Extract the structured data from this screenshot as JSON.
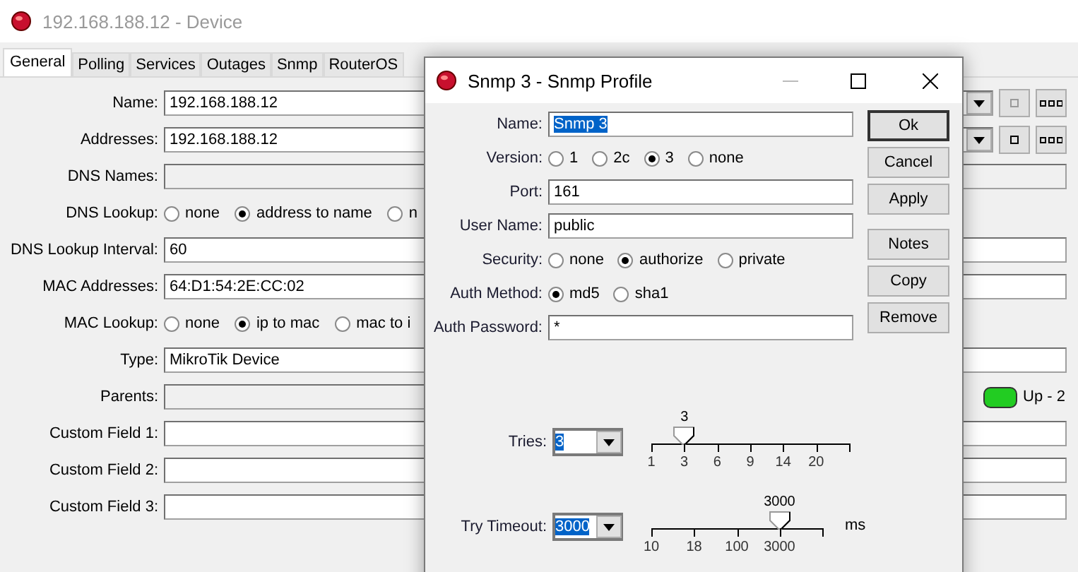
{
  "device_window": {
    "title": "192.168.188.12 - Device",
    "tabs": [
      {
        "label": "General",
        "selected": true
      },
      {
        "label": "Polling",
        "selected": false
      },
      {
        "label": "Services",
        "selected": false
      },
      {
        "label": "Outages",
        "selected": false
      },
      {
        "label": "Snmp",
        "selected": false
      },
      {
        "label": "RouterOS",
        "selected": false
      }
    ],
    "fields": [
      {
        "kind": "combo",
        "label": "Name:",
        "value": "192.168.188.12",
        "disabled": false
      },
      {
        "kind": "combo",
        "label": "Addresses:",
        "value": "192.168.188.12",
        "disabled": false
      },
      {
        "kind": "text",
        "label": "DNS Names:",
        "disabled": true
      },
      {
        "kind": "radio",
        "label": "DNS Lookup:",
        "options": [
          {
            "label": "none",
            "selected": false
          },
          {
            "label": "address to name",
            "selected": true
          },
          {
            "label": "n",
            "selected": false
          }
        ]
      },
      {
        "kind": "text",
        "label": "DNS Lookup Interval:",
        "value": "60",
        "disabled": false
      },
      {
        "kind": "text",
        "label": "MAC Addresses:",
        "value": "64:D1:54:2E:CC:02",
        "disabled": false
      },
      {
        "kind": "radio",
        "label": "MAC Lookup:",
        "options": [
          {
            "label": "none",
            "selected": false
          },
          {
            "label": "ip to mac",
            "selected": true
          },
          {
            "label": "mac to i",
            "selected": false
          }
        ]
      },
      {
        "kind": "text",
        "label": "Type:",
        "value": "MikroTik Device",
        "disabled": false
      },
      {
        "kind": "status",
        "label": "Parents:",
        "disabled": true,
        "status": "Up - 2"
      },
      {
        "kind": "text",
        "label": "Custom Field 1:",
        "disabled": false
      },
      {
        "kind": "text",
        "label": "Custom Field 2:",
        "disabled": false
      },
      {
        "kind": "text",
        "label": "Custom Field 3:",
        "disabled": false
      }
    ]
  },
  "snmp_dialog": {
    "title": "Snmp 3 - Snmp Profile",
    "fields": [
      {
        "kind": "text",
        "label": "Name:",
        "value": "Snmp 3",
        "highlighted": true
      },
      {
        "kind": "radio",
        "label": "Version:",
        "options": [
          {
            "label": "1",
            "selected": false
          },
          {
            "label": "2c",
            "selected": false
          },
          {
            "label": "3",
            "selected": true
          },
          {
            "label": "none",
            "selected": false
          }
        ]
      },
      {
        "kind": "text",
        "label": "Port:",
        "value": "161",
        "highlighted": false
      },
      {
        "kind": "text",
        "label": "User Name:",
        "value": "public",
        "highlighted": false
      },
      {
        "kind": "radio",
        "label": "Security:",
        "options": [
          {
            "label": "none",
            "selected": false
          },
          {
            "label": "authorize",
            "selected": true
          },
          {
            "label": "private",
            "selected": false
          }
        ]
      },
      {
        "kind": "radio",
        "label": "Auth Method:",
        "options": [
          {
            "label": "md5",
            "selected": true
          },
          {
            "label": "sha1",
            "selected": false
          }
        ]
      },
      {
        "kind": "text",
        "label": "Auth Password:",
        "value": "*",
        "highlighted": false
      }
    ],
    "sliders": [
      {
        "label": "Tries:",
        "value": "3",
        "thumb_label": "3",
        "ticks": [
          "1",
          "3",
          "6",
          "9",
          "14",
          "20"
        ],
        "level": 0.167
      },
      {
        "label": "Try Timeout:",
        "value": "3000",
        "thumb_label": "3000",
        "ticks": [
          "10",
          "18",
          "100",
          "3000"
        ],
        "unit": "ms",
        "level": 0.75
      }
    ],
    "button_groups": [
      {
        "buttons": [
          {
            "label": "Ok",
            "default": true
          },
          {
            "label": "Cancel",
            "default": false
          },
          {
            "label": "Apply",
            "default": false
          }
        ]
      },
      {
        "buttons": [
          {
            "label": "Notes",
            "default": false
          },
          {
            "label": "Copy",
            "default": false
          },
          {
            "label": "Remove",
            "default": false
          }
        ]
      }
    ]
  }
}
